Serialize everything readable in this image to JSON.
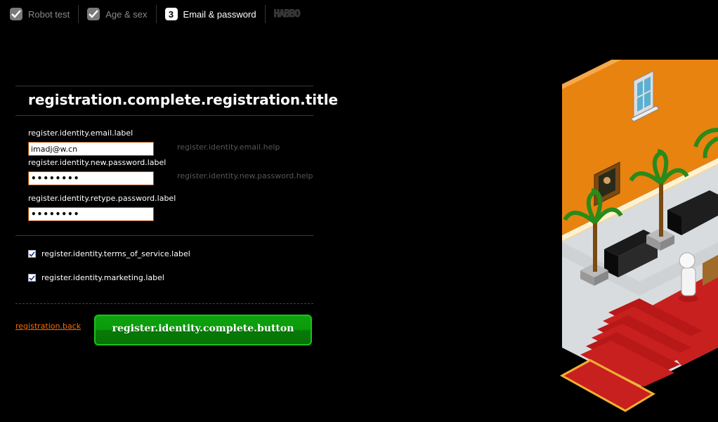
{
  "steps": [
    {
      "label": "Robot test",
      "state": "done"
    },
    {
      "label": "Age & sex",
      "state": "done"
    },
    {
      "number": "3",
      "label": "Email & password",
      "state": "active"
    }
  ],
  "logo_text": "HABBO",
  "form": {
    "title": "registration.complete.registration.title",
    "email": {
      "label": "register.identity.email.label",
      "value": "imadj@w.cn",
      "help": "register.identity.email.help"
    },
    "new_password": {
      "label": "register.identity.new.password.label",
      "value": "••••••••",
      "help": "register.identity.new.password.help"
    },
    "retype_password": {
      "label": "register.identity.retype.password.label",
      "value": "••••••••"
    },
    "terms": {
      "label": "register.identity.terms_of_service.label",
      "checked": true
    },
    "marketing": {
      "label": "register.identity.marketing.label",
      "checked": true
    },
    "back_link": "registration.back",
    "complete_button": "register.identity.complete.button"
  },
  "colors": {
    "background": "#000000",
    "accent_orange": "#ff6a00",
    "button_green": "#0a9a0a",
    "wall_orange": "#e8830f",
    "carpet_red": "#c8201e"
  }
}
